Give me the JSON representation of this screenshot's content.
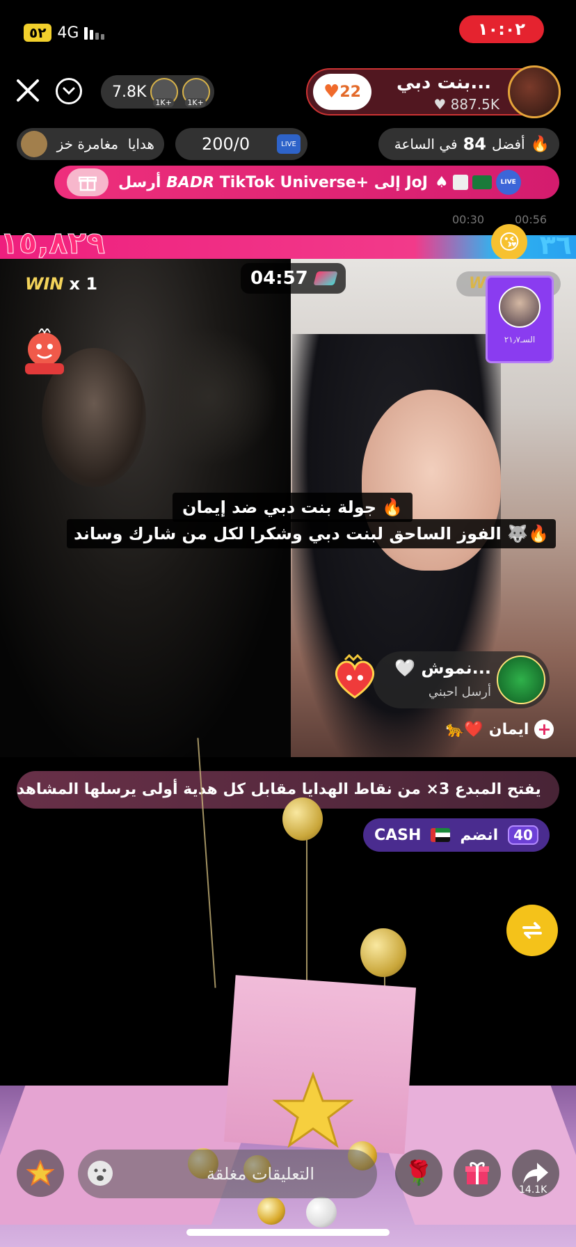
{
  "status_bar": {
    "battery": "٥٢",
    "network": "4G",
    "time": "١٠:٠٢"
  },
  "header": {
    "viewer_count": "7.8K",
    "viewer_badges": [
      "1K+",
      "1K+"
    ],
    "like_badge": "22",
    "host_name": "بنت دبي...",
    "host_likes": "887.5K"
  },
  "row2": {
    "gifts_label": "هدايا",
    "adventure_label": "مغامرة خز",
    "score": "200/0",
    "rank_prefix": "أفضل",
    "rank_number": "84",
    "rank_suffix": "في الساعة"
  },
  "banner": {
    "text": "أرسل 𝘽𝘼𝘿𝙍 TikTok Universe+ إلى JoJ"
  },
  "mini_timers": [
    "00:30",
    "00:56"
  ],
  "battle": {
    "score_left": "١٥,٨٢٩",
    "score_right": "٣٦"
  },
  "left_panel": {
    "win_label": "WIN",
    "win_count": "x 1"
  },
  "timer": "04:57",
  "right_panel": {
    "win_label": "WIN",
    "guest_card_label": "السـ٢١٫٧"
  },
  "caption": {
    "line1": "جولة بنت دبي ضد إيمان 🔥",
    "line2": "الفوز الساحق لبنت دبي  وشكرا لكل من شارك وساند 🐺🔥"
  },
  "gift_note": {
    "name": "نموش...",
    "sub": "أرسل احبني"
  },
  "guest": {
    "name": "ايمان",
    "suffix": "🐆❤️"
  },
  "notice": "يفتح المبدع 3× من نقاط الهدايا مقابل كل هدية أولى يرسلها المشاهد",
  "join": {
    "coins": "40",
    "label": "انضم",
    "cash": "CASH"
  },
  "comments_placeholder": "التعليقات مغلقة",
  "share_count": "14.1K",
  "colors": {
    "accent_pink": "#ee2f7c",
    "accent_blue": "#28a0f0",
    "time_red": "#e5232f",
    "swap_yellow": "#f4c21a"
  }
}
